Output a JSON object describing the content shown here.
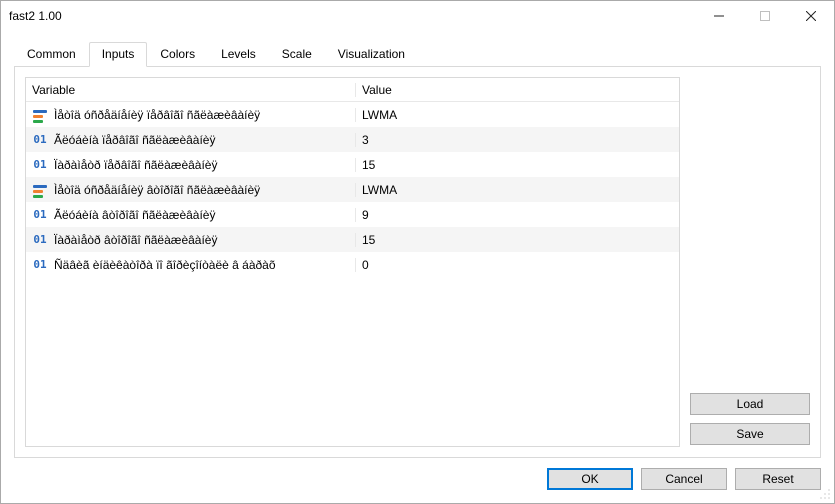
{
  "window": {
    "title": "fast2 1.00"
  },
  "tabs": [
    "Common",
    "Inputs",
    "Colors",
    "Levels",
    "Scale",
    "Visualization"
  ],
  "active_tab_index": 1,
  "grid": {
    "headers": {
      "variable": "Variable",
      "value": "Value"
    },
    "rows": [
      {
        "icon": "enum",
        "variable": "Ìåòîä óñðåäíåíèÿ ïåðâîãî ñãëàæèâàíèÿ",
        "value": "LWMA"
      },
      {
        "icon": "int",
        "variable": "Ãëóáèíà  ïåðâîãî ñãëàæèâàíèÿ",
        "value": "3"
      },
      {
        "icon": "int",
        "variable": "Ïàðàìåòð ïåðâîãî ñãëàæèâàíèÿ",
        "value": "15"
      },
      {
        "icon": "enum",
        "variable": "Ìåòîä óñðåäíåíèÿ âòîðîãî ñãëàæèâàíèÿ",
        "value": "LWMA"
      },
      {
        "icon": "int",
        "variable": "Ãëóáèíà  âòîðîãî ñãëàæèâàíèÿ",
        "value": "9"
      },
      {
        "icon": "int",
        "variable": "Ïàðàìåòð âòîðîãî ñãëàæèâàíèÿ",
        "value": "15"
      },
      {
        "icon": "int",
        "variable": "Ñäâèã èíäèêàòîðà ïî ãîðèçîíòàëè â áàðàõ",
        "value": "0"
      }
    ]
  },
  "side_buttons": {
    "load": "Load",
    "save": "Save"
  },
  "bottom_buttons": {
    "ok": "OK",
    "cancel": "Cancel",
    "reset": "Reset"
  }
}
